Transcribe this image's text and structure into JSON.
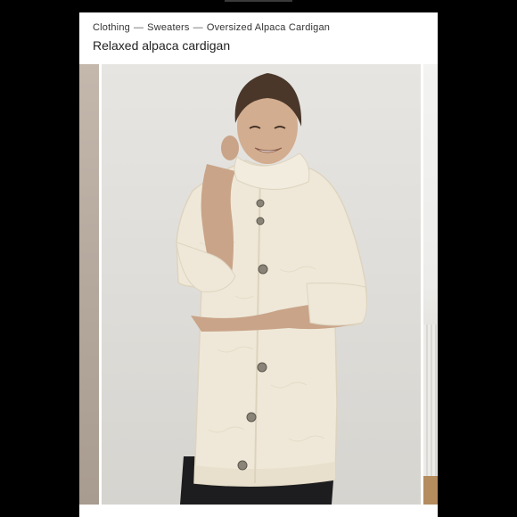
{
  "breadcrumb": {
    "items": [
      "Clothing",
      "Sweaters",
      "Oversized Alpaca Cardigan"
    ],
    "separator": "—"
  },
  "product": {
    "title": "Relaxed alpaca cardigan"
  },
  "gallery": {
    "active_index": 1,
    "images": [
      "product-photo-previous",
      "product-photo-main",
      "product-photo-next"
    ]
  },
  "colors": {
    "background": "#000000",
    "card": "#ffffff",
    "text": "#333333",
    "cardigan": "#efe8d8"
  }
}
